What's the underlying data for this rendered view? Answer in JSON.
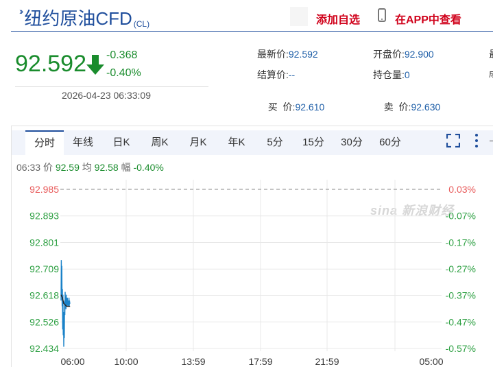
{
  "header": {
    "title": "纽约原油CFD",
    "code": "(CL)",
    "add_favorite": "添加自选",
    "view_in_app": "在APP中查看",
    "icons": [
      "double-chevron-icon",
      "phone-icon"
    ]
  },
  "price": {
    "last": "92.592",
    "change": "-0.368",
    "change_pct": "-0.40%",
    "direction_icon": "down-arrow-icon",
    "timestamp": "2026-04-23 06:33:09",
    "color": "#1a8c2d"
  },
  "quote": {
    "latest_label": "最新价:",
    "latest_value": "92.592",
    "settle_label": "结算价:",
    "settle_value": "--",
    "bid_label": "买  价:",
    "bid_value": "92.610",
    "open_label": "开盘价:",
    "open_value": "92.900",
    "oi_label": "持仓量:",
    "oi_value": "0",
    "ask_label": "卖  价:",
    "ask_value": "92.630",
    "cut_label_1": "最",
    "cut_label_2": "成"
  },
  "tabs": [
    "分时",
    "年线",
    "日K",
    "周K",
    "月K",
    "年K",
    "5分",
    "15分",
    "30分",
    "60分"
  ],
  "active_tab": "分时",
  "toolbar_icons": [
    "fullscreen-icon",
    "more-vertical-icon"
  ],
  "info": {
    "time": "06:33",
    "price_label": "价",
    "price_value": "92.59",
    "avg_label": "均",
    "avg_value": "92.58",
    "amp_label": "幅",
    "amp_value": "-0.40%"
  },
  "watermark": "sina 新浪财经",
  "colors": {
    "up": "#e85a5a",
    "down": "#2ea043",
    "price_line": "#1a82c8",
    "avg_line": "#222222",
    "grid": "#e8e8e8"
  },
  "chart_data": {
    "type": "line",
    "title": "",
    "xlabel": "",
    "ylabel": "",
    "x_ticks": [
      "06:00",
      "10:00",
      "13:59",
      "17:59",
      "21:59",
      "05:00"
    ],
    "y_ticks": [
      92.985,
      92.893,
      92.801,
      92.709,
      92.618,
      92.526,
      92.434
    ],
    "y_tick_labels": [
      "92.985",
      "92.893",
      "92.801",
      "92.709",
      "92.618",
      "92.526",
      "92.434"
    ],
    "y2_tick_labels": [
      "0.03%",
      "-0.07%",
      "-0.17%",
      "-0.27%",
      "-0.37%",
      "-0.47%",
      "-0.57%"
    ],
    "ylim": [
      92.434,
      92.985
    ],
    "reference_price": 92.96,
    "grid": true,
    "series": [
      {
        "color": "#1a82c8",
        "x": [
          "06:00",
          "06:01",
          "06:02",
          "06:03",
          "06:04",
          "06:05",
          "06:06",
          "06:07",
          "06:08",
          "06:09",
          "06:10",
          "06:11",
          "06:12",
          "06:13",
          "06:14",
          "06:15",
          "06:16",
          "06:17",
          "06:18",
          "06:19",
          "06:20",
          "06:21",
          "06:22",
          "06:23",
          "06:24",
          "06:25",
          "06:26",
          "06:27",
          "06:28",
          "06:29",
          "06:30",
          "06:31",
          "06:32",
          "06:33"
        ],
        "values": [
          92.6,
          92.74,
          92.68,
          92.72,
          92.58,
          92.64,
          92.5,
          92.62,
          92.48,
          92.56,
          92.44,
          92.52,
          92.47,
          92.6,
          92.55,
          92.63,
          92.58,
          92.61,
          92.57,
          92.62,
          92.59,
          92.6,
          92.58,
          92.61,
          92.59,
          92.6,
          92.58,
          92.6,
          92.59,
          92.61,
          92.58,
          92.6,
          92.59,
          92.592
        ]
      },
      {
        "color": "#222222",
        "x": [
          "06:00",
          "06:05",
          "06:10",
          "06:15",
          "06:20",
          "06:25",
          "06:30",
          "06:33"
        ],
        "values": [
          92.62,
          92.61,
          92.59,
          92.585,
          92.58,
          92.58,
          92.58,
          92.58
        ]
      }
    ]
  }
}
